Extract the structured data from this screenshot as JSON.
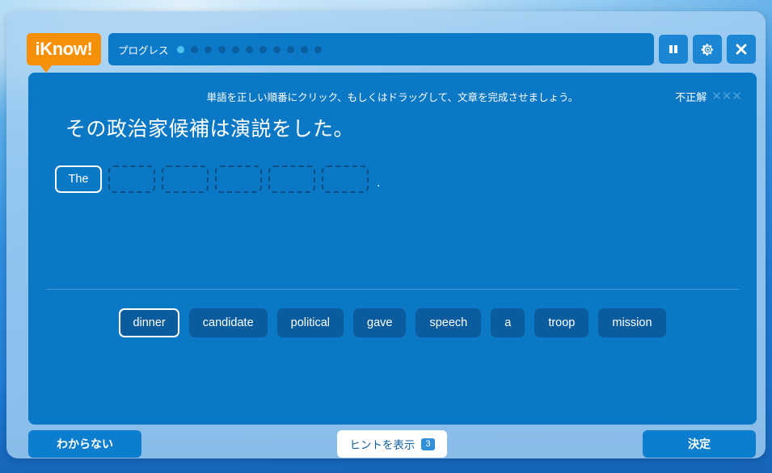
{
  "app": {
    "logo_text": "iKnow!",
    "brand_color": "#f79009",
    "panel_color": "#0b78c6",
    "accent_color": "#0d7dcd"
  },
  "header": {
    "progress_label": "プログレス",
    "progress_total": 11,
    "progress_current_index": 0,
    "buttons": [
      {
        "name": "pause-button",
        "icon": "pause-icon"
      },
      {
        "name": "settings-button",
        "icon": "gear-icon"
      },
      {
        "name": "close-button",
        "icon": "close-icon"
      }
    ]
  },
  "main": {
    "instruction": "単語を正しい順番にクリック、もしくはドラッグして、文章を完成させましょう。",
    "result_label": "不正解",
    "result_marks": [
      "✕",
      "✕",
      "✕"
    ],
    "japanese_sentence": "その政治家候補は演説をした。",
    "answer_slots": [
      {
        "text": "The",
        "filled": true
      },
      {
        "text": "",
        "filled": false
      },
      {
        "text": "",
        "filled": false
      },
      {
        "text": "",
        "filled": false
      },
      {
        "text": "",
        "filled": false
      },
      {
        "text": "",
        "filled": false
      }
    ],
    "sentence_terminator": ".",
    "word_bank": [
      {
        "label": "dinner",
        "selected": true
      },
      {
        "label": "candidate",
        "selected": false
      },
      {
        "label": "political",
        "selected": false
      },
      {
        "label": "gave",
        "selected": false
      },
      {
        "label": "speech",
        "selected": false
      },
      {
        "label": "a",
        "selected": false
      },
      {
        "label": "troop",
        "selected": false
      },
      {
        "label": "mission",
        "selected": false
      }
    ]
  },
  "footer": {
    "dont_know_label": "わからない",
    "hint_label": "ヒントを表示",
    "hint_count": "3",
    "submit_label": "決定"
  }
}
